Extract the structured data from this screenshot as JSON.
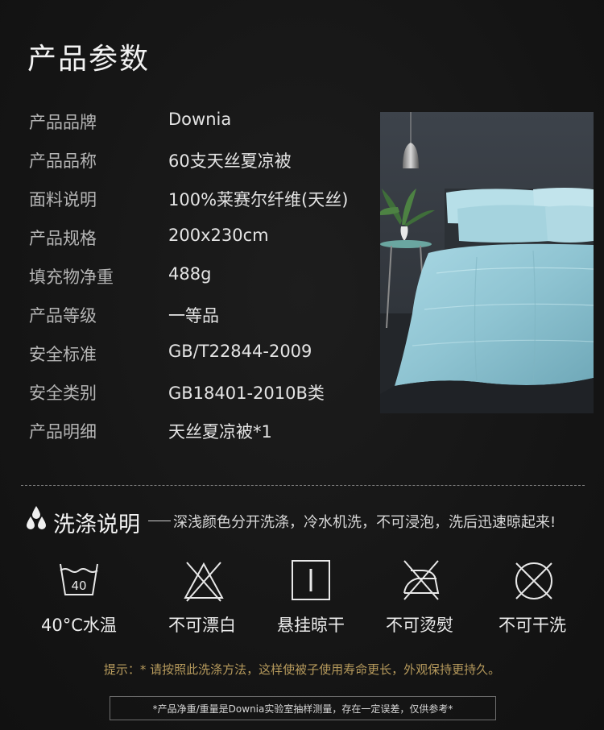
{
  "title": "产品参数",
  "specs": [
    {
      "label": "产品品牌",
      "value": "Downia"
    },
    {
      "label": "产品品称",
      "value": "60支天丝夏凉被"
    },
    {
      "label": "面料说明",
      "value": "100%莱赛尔纤维(天丝)"
    },
    {
      "label": "产品规格",
      "value": "200x230cm"
    },
    {
      "label": "填充物净重",
      "value": "488g"
    },
    {
      "label": "产品等级",
      "value": "一等品"
    },
    {
      "label": "安全标准",
      "value": "GB/T22844-2009"
    },
    {
      "label": "安全类别",
      "value": "GB18401-2010B类"
    },
    {
      "label": "产品明细",
      "value": "天丝夏凉被*1"
    }
  ],
  "wash": {
    "heading": "洗涤说明",
    "description": "深浅颜色分开洗涤，冷水机洗，不可浸泡，洗后迅速晾起来!",
    "icons": [
      {
        "icon": "wash-40-icon",
        "label": "40°C水温",
        "temp": "40"
      },
      {
        "icon": "no-bleach-icon",
        "label": "不可漂白"
      },
      {
        "icon": "hang-dry-icon",
        "label": "悬挂晾干"
      },
      {
        "icon": "no-iron-icon",
        "label": "不可烫熨"
      },
      {
        "icon": "no-dry-clean-icon",
        "label": "不可干洗"
      }
    ]
  },
  "tip": "提示：* 请按照此洗涤方法，这样使被子使用寿命更长，外观保持更持久。",
  "note": "*产品净重/重量是Downia实验室抽样测量，存在一定误差，仅供参考*",
  "colors": {
    "background": "#151515",
    "tip": "#b69a5c",
    "quilt": "#9ccfdc"
  }
}
